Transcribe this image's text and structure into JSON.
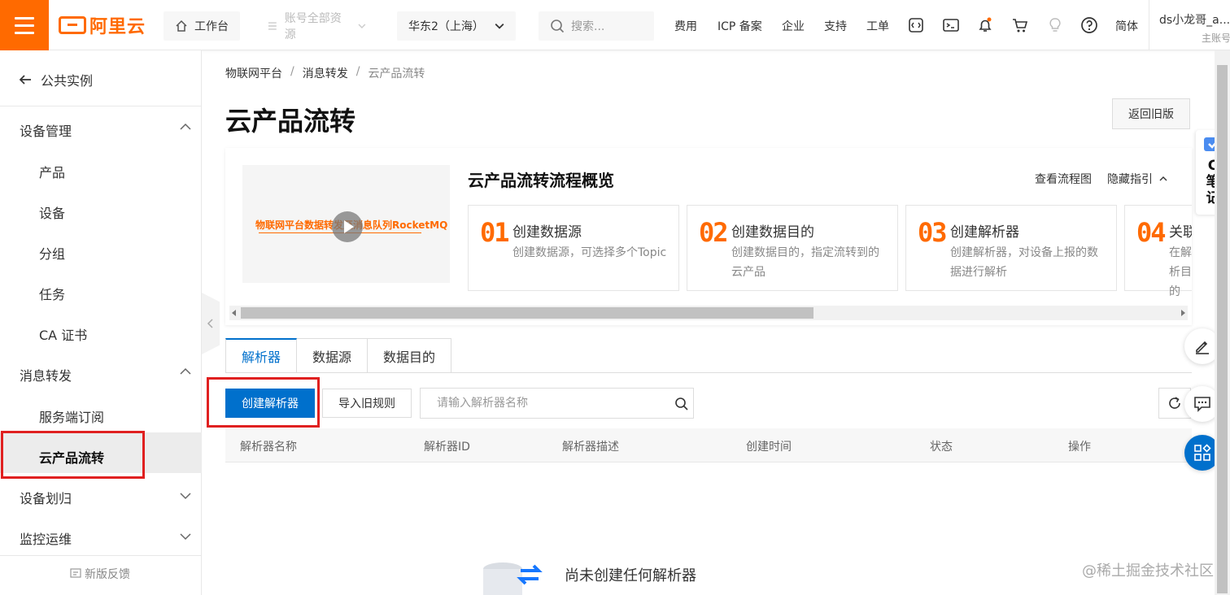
{
  "topbar": {
    "logo_text": "阿里云",
    "workbench": "工作台",
    "resource_scope": "账号全部资源",
    "region": "华东2（上海）",
    "search_placeholder": "搜索...",
    "links": [
      "费用",
      "ICP 备案",
      "企业",
      "支持",
      "工单"
    ],
    "language": "简体",
    "user_name": "ds小龙哥_a...",
    "user_role": "主账号"
  },
  "sidebar": {
    "back_label": "公共实例",
    "groups": [
      {
        "label": "设备管理",
        "expanded": true,
        "items": [
          "产品",
          "设备",
          "分组",
          "任务",
          "CA 证书"
        ]
      },
      {
        "label": "消息转发",
        "expanded": true,
        "items": [
          "服务端订阅",
          "云产品流转"
        ]
      },
      {
        "label": "设备划归",
        "expanded": false
      },
      {
        "label": "监控运维",
        "expanded": false
      }
    ],
    "active_item": "云产品流转",
    "feedback": "新版反馈"
  },
  "breadcrumb": [
    "物联网平台",
    "消息转发",
    "云产品流转"
  ],
  "page_title": "云产品流转",
  "back_old_label": "返回旧版",
  "guide": {
    "title": "云产品流转流程概览",
    "view_flow": "查看流程图",
    "hide_guide": "隐藏指引",
    "video_caption": "物联网平台数据转发至消息队列RocketMQ",
    "steps": [
      {
        "num": "01",
        "title": "创建数据源",
        "desc": "创建数据源，可选择多个Topic"
      },
      {
        "num": "02",
        "title": "创建数据目的",
        "desc": "创建数据目的，指定流转到的云产品"
      },
      {
        "num": "03",
        "title": "创建解析器",
        "desc": "创建解析器，对设备上报的数据进行解析"
      },
      {
        "num": "04",
        "title": "关联",
        "desc": "在解析目的"
      }
    ]
  },
  "tabs": [
    "解析器",
    "数据源",
    "数据目的"
  ],
  "active_tab": "解析器",
  "toolbar": {
    "create_label": "创建解析器",
    "import_label": "导入旧规则",
    "search_placeholder": "请输入解析器名称"
  },
  "table": {
    "columns": [
      "解析器名称",
      "解析器ID",
      "解析器描述",
      "创建时间",
      "状态",
      "操作"
    ]
  },
  "empty_state": "尚未创建任何解析器",
  "note_widget": "C笔记",
  "watermark": "@稀土掘金技术社区",
  "colors": {
    "brand": "#ff6a00",
    "primary": "#0070cc",
    "highlight": "#e02020"
  }
}
